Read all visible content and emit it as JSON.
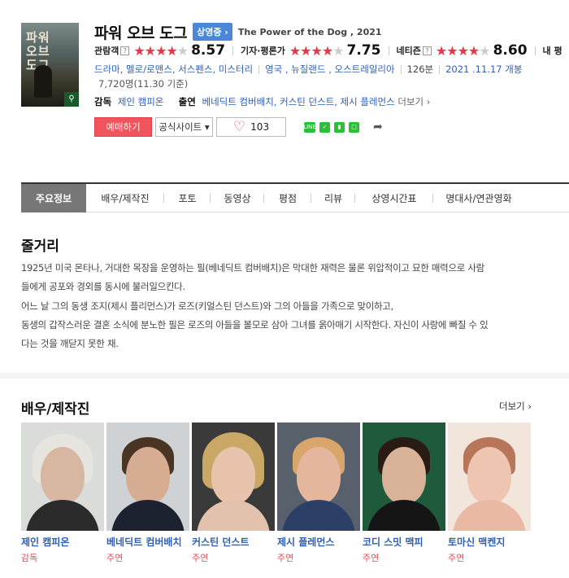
{
  "movie": {
    "title": "파워 오브 도그",
    "status_badge": "상영중 ›",
    "original_title": "The Power of the Dog , 2021",
    "poster_text": "파워\n오브\n도그"
  },
  "ratings": [
    {
      "label": "관람객",
      "stars_full": 4,
      "score": "8.57"
    },
    {
      "label": "기자·평론가",
      "stars_full": 4,
      "score": "7.75"
    },
    {
      "label": "네티즌",
      "stars_full": 4,
      "score": "8.60"
    },
    {
      "label": "내 평"
    }
  ],
  "meta": {
    "genres": "드라마, 멜로/로맨스, 서스펜스, 미스터리",
    "countries": "영국 , 뉴질랜드 , 오스트레일리아",
    "runtime": "126분",
    "release": "2021 .11.17 개봉",
    "audience": "7,720명(11.30 기준)"
  },
  "credits": {
    "director_label": "감독",
    "director": "제인 캠피온",
    "cast_label": "출연",
    "cast": "베네딕트 컴버배치, 커스틴 던스트, 제시 플레먼스",
    "more": "더보기 ›"
  },
  "actions": {
    "book": "예매하기",
    "official_site": "공식사이트 ▾",
    "like_count": "103"
  },
  "tabs": [
    "주요정보",
    "배우/제작진",
    "포토",
    "동영상",
    "평점",
    "리뷰",
    "상영시간표",
    "명대사/연관영화"
  ],
  "synopsis": {
    "title": "줄거리",
    "lines": [
      "1925년 미국 몬타나, 거대한 목장을 운영하는 필(베네딕트 컴버배치)은 막대한 재력은 물론 위압적이고 묘한 매력으로 사람",
      "들에게 공포와 경외를 동시에 불러일으킨다.",
      " 어느 날 그의 동생 조지(제시 플리먼스)가 로즈(키얼스틴 던스트)와 그의 아들을 가족으로 맞이하고,",
      " 동생의 갑작스러운 결혼 소식에 분노한 필은 로즈의 아들을 볼모로 삼아 그녀를 옭아매기 시작한다. 자신이 사랑에 빠질 수 있",
      "다는 것을 깨닫지 못한 채."
    ]
  },
  "cast_section": {
    "title": "배우/제작진",
    "more": "더보기 ›",
    "people": [
      {
        "name": "제인 캠피온",
        "role": "감독"
      },
      {
        "name": "베네딕트 컴버배치",
        "role": "주연"
      },
      {
        "name": "커스틴 던스트",
        "role": "주연"
      },
      {
        "name": "제시 플레먼스",
        "role": "주연"
      },
      {
        "name": "코디 스밋 맥피",
        "role": "주연"
      },
      {
        "name": "토마신 맥켄지",
        "role": "주연"
      }
    ]
  },
  "colors": {
    "accent_red": "#f0555d",
    "link_blue": "#2e5fb5",
    "badge_blue": "#4a87d6",
    "star_red": "#e8364a"
  }
}
